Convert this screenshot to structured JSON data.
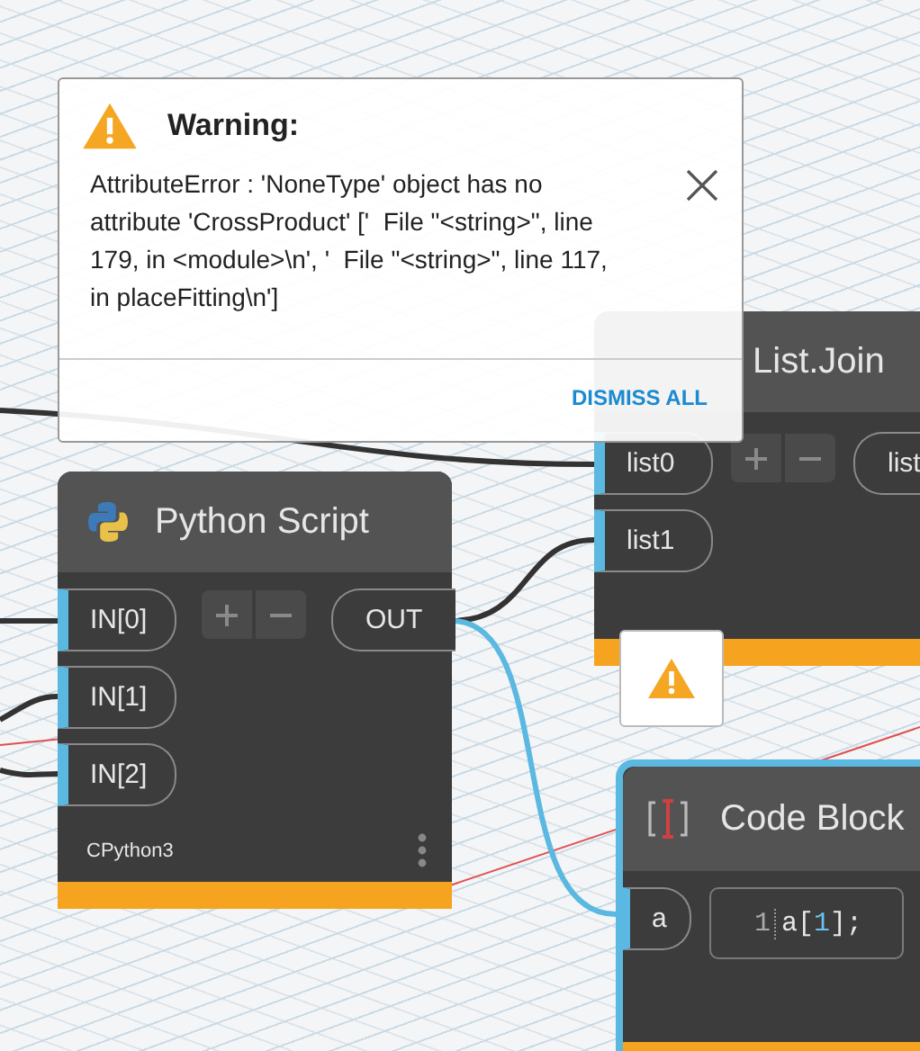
{
  "popup": {
    "title": "Warning:",
    "message": "AttributeError : 'NoneType' object has no attribute 'CrossProduct' ['  File \"<string>\", line 179, in <module>\\n', '  File \"<string>\", line 117, in placeFitting\\n']",
    "action": "DISMISS ALL"
  },
  "nodes": [
    {
      "kind": "list",
      "title": "List.Join",
      "inputs": [
        "list0",
        "list1"
      ],
      "output": "list",
      "selected": false
    },
    {
      "kind": "python",
      "title": "Python Script",
      "inputs": [
        "IN[0]",
        "IN[1]",
        "IN[2]"
      ],
      "output": "OUT",
      "footer": "CPython3",
      "selected": false
    },
    {
      "kind": "code",
      "title": "Code Block",
      "inputs": [
        "a"
      ],
      "line_number": "1",
      "code": [
        {
          "text": "a[",
          "kind": "plain"
        },
        {
          "text": "1",
          "kind": "number"
        },
        {
          "text": "];",
          "kind": "plain"
        }
      ],
      "selected": true,
      "warning": true
    }
  ]
}
